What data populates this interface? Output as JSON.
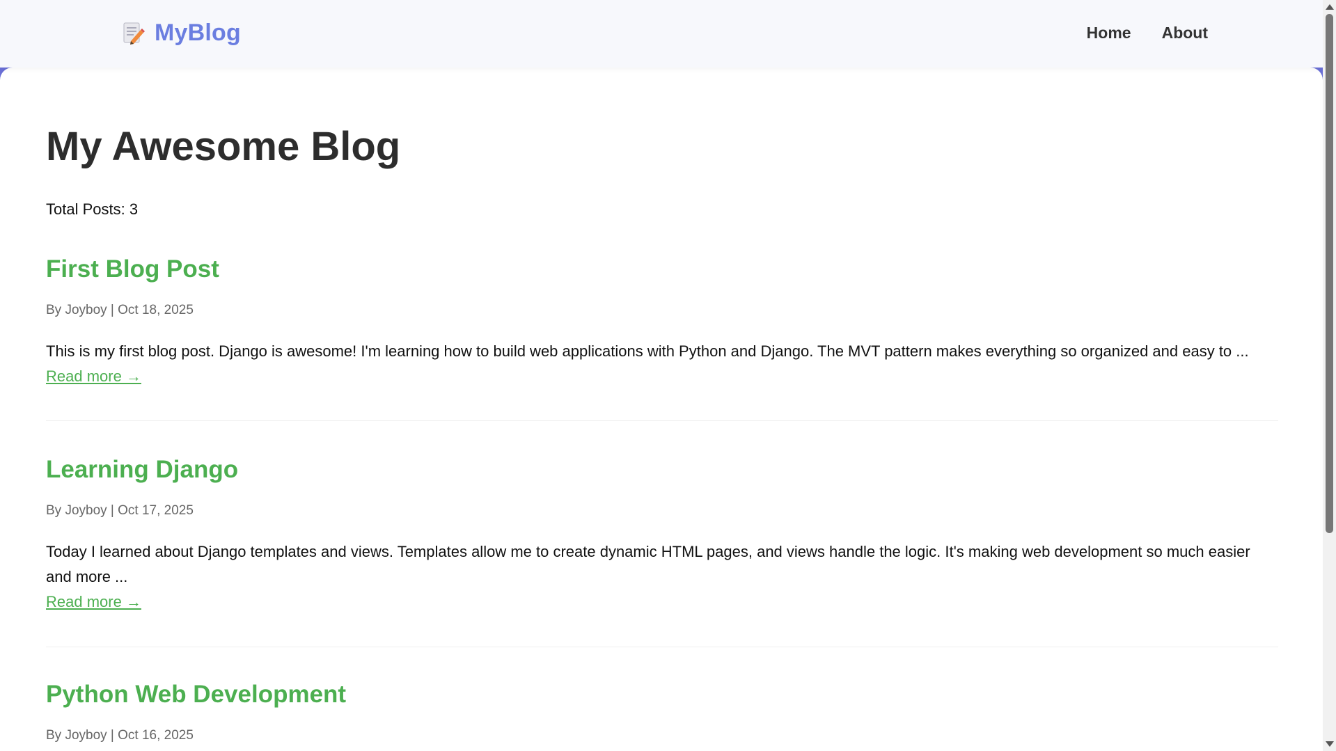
{
  "navbar": {
    "brand_icon": "memo-pencil-icon",
    "brand_name": "MyBlog",
    "links": [
      {
        "label": "Home"
      },
      {
        "label": "About"
      }
    ]
  },
  "page": {
    "title": "My Awesome Blog",
    "total_posts": "Total Posts: 3"
  },
  "posts": [
    {
      "title": "First Blog Post",
      "meta": "By Joyboy | Oct 18, 2025",
      "excerpt": "This is my first blog post. Django is awesome! I'm learning how to build web applications with Python and Django. The MVT pattern makes everything so organized and easy to ...",
      "read_more": "Read more →"
    },
    {
      "title": "Learning Django",
      "meta": "By Joyboy | Oct 17, 2025",
      "excerpt": "Today I learned about Django templates and views. Templates allow me to create dynamic HTML pages, and views handle the logic. It's making web development so much easier and more ...",
      "read_more": "Read more →"
    },
    {
      "title": "Python Web Development",
      "meta": "By Joyboy | Oct 16, 2025"
    }
  ],
  "colors": {
    "brand": "#6b7ee0",
    "accent": "#6a6fd6",
    "post_title": "#4caf50",
    "navbar_bg": "#f7f8fc"
  }
}
